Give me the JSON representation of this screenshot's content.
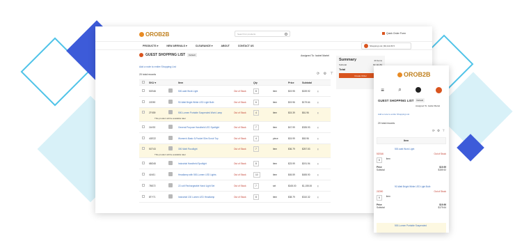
{
  "colors": {
    "accent": "#d9541e",
    "brand": "#e88b24",
    "link": "#3a6fbd",
    "highlight": "#fdf8e1",
    "decor_blue": "#3d5bd9",
    "decor_cyan": "#4fc3e8"
  },
  "desktop": {
    "logo": "OROB2B",
    "search_placeholder": "Search for products",
    "quick_order": "Quick Order Form",
    "nav": [
      "PRODUCTS ▾",
      "NEW ARRIVALS ▾",
      "CLEARANCE ▾",
      "ABOUT",
      "CONTACT US"
    ],
    "shopping_list_widget": "Shopping List | $3,111.83 ▾",
    "title": "GUEST SHOPPING LIST",
    "title_badge": "Default",
    "assigned": "Assigned To: Isabel Martel",
    "add_note": "Add a note to entire Shopping List",
    "records": "20 total records",
    "toolbar_icons": "⟳ ⚙ ⊤",
    "summary": {
      "title": "Summary",
      "items": "20 Items",
      "subtotal_label": "Subtotal",
      "subtotal_value": "$3,111.83",
      "total_label": "Total",
      "total_value": "$3,111",
      "button": "Create Order"
    },
    "columns": [
      "SKU ▾",
      "Item",
      "Qty",
      "Price",
      "Subtotal"
    ],
    "rows": [
      {
        "sku": "5GS46",
        "item": "500-watt Work Light",
        "stock": "Out of Stock",
        "qty": "8",
        "unit": "item",
        "price": "$19.95",
        "subtotal": "$159.92",
        "note": ""
      },
      {
        "sku": "2JD90",
        "item": "90-Watt Bright White LED Light Bulb",
        "stock": "Out of Stock",
        "qty": "6",
        "unit": "item",
        "price": "$19.96",
        "subtotal": "$179.64",
        "note": ""
      },
      {
        "sku": "2TK59",
        "item": "500-Lumen Portable Suspended Work Lamp",
        "stock": "Out of Stock",
        "qty": "4",
        "unit": "item",
        "price": "$15.39",
        "subtotal": "$61.96",
        "note": "This product will be available later"
      },
      {
        "sku": "2LK92",
        "item": "General Purpose Handheld LED Spotlight",
        "stock": "Out of Stock",
        "qty": "7",
        "unit": "item",
        "price": "$47.99",
        "subtotal": "$335.93",
        "note": ""
      },
      {
        "sku": "4GE22",
        "item": "Women's Basic 5-Pocket Slim Scrub Top",
        "stock": "Out of Stock",
        "qty": "4",
        "unit": "piece",
        "price": "$15.99",
        "subtotal": "$63.96",
        "note": ""
      },
      {
        "sku": "5GT43",
        "item": "300-Watt Floodlight",
        "stock": "Out of Stock",
        "qty": "7",
        "unit": "item",
        "price": "$36.79",
        "subtotal": "$257.53",
        "note": "This product will be available later"
      },
      {
        "sku": "6BO45",
        "item": "Industrial Handheld Spotlight",
        "stock": "Out of Stock",
        "qty": "8",
        "unit": "item",
        "price": "$23.99",
        "subtotal": "$191.94",
        "note": ""
      },
      {
        "sku": "4LV61",
        "item": "Headlamp with 500-Lumen LED Lights",
        "stock": "Out of Stock",
        "qty": "10",
        "unit": "item",
        "price": "$45.59",
        "subtotal": "$455.90",
        "note": ""
      },
      {
        "sku": "7BS72",
        "item": "22-volt Rechargeable Hand Light Set",
        "stock": "Out of Stock",
        "qty": "7",
        "unit": "set",
        "price": "$165.00",
        "subtotal": "$1,155.00",
        "note": ""
      },
      {
        "sku": "8TY71",
        "item": "Industrial 130 Lumen LED Headlamp",
        "stock": "Out of Stock",
        "qty": "8",
        "unit": "item",
        "price": "$38.79",
        "subtotal": "$310.32",
        "note": ""
      }
    ]
  },
  "mobile": {
    "logo": "OROB2B",
    "title": "GUEST SHOPPING LIST",
    "badge": "Default",
    "assigned": "Assigned To: Isabel Martel",
    "add_note": "Add a note to entire Shopping List",
    "records": "20 total records",
    "toolbar_icons": "⟳ ⚙ ⊤",
    "head_label": "Item",
    "items": [
      {
        "name": "500-watt Work Light",
        "sku": "5GS46",
        "stock": "Out of Stock",
        "qty": "8",
        "unit": "item",
        "price_label": "Price",
        "price": "$19.99",
        "sub_label": "Subtotal",
        "subtotal": "$159.92"
      },
      {
        "name": "90-Watt Bright White LED Light Bulb",
        "sku": "2JD90",
        "stock": "Out of Stock",
        "qty": "9",
        "unit": "item",
        "price_label": "Price",
        "price": "$19.96",
        "sub_label": "Subtotal",
        "subtotal": "$179.64"
      }
    ],
    "last_item": "500-Lumen Portable Suspended"
  }
}
